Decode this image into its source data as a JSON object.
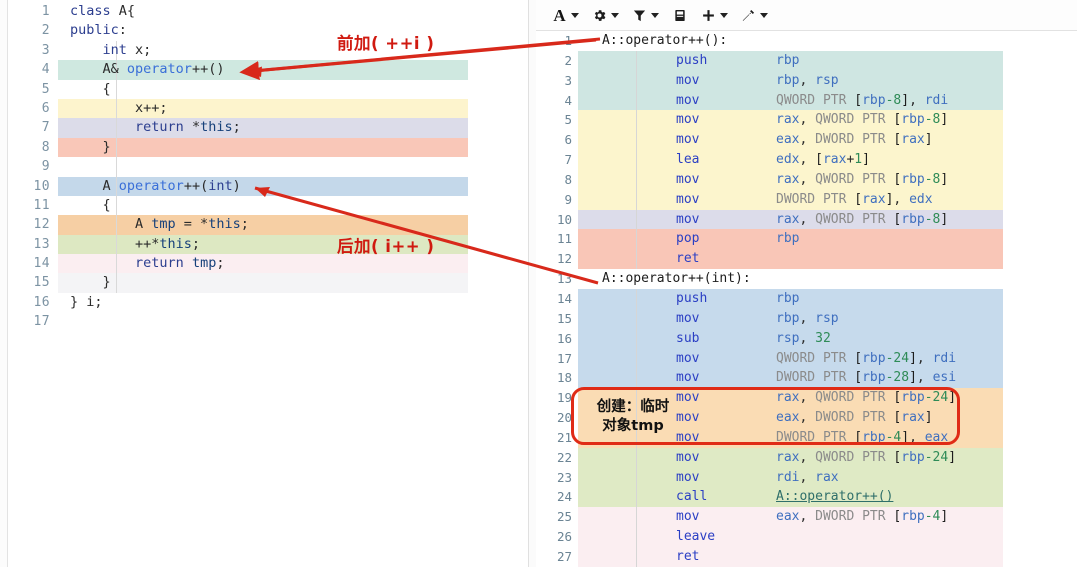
{
  "toolbar": {
    "buttons": [
      {
        "name": "font-button",
        "icon": "letter-A-icon",
        "label": "A",
        "caret": true
      },
      {
        "name": "settings-button",
        "icon": "gear-icon",
        "label": "",
        "caret": true
      },
      {
        "name": "filter-button",
        "icon": "filter-funnel-icon",
        "label": "",
        "caret": true
      },
      {
        "name": "layout-button",
        "icon": "panel-book-icon",
        "label": "",
        "caret": false
      },
      {
        "name": "add-button",
        "icon": "plus-icon",
        "label": "",
        "caret": true
      },
      {
        "name": "tools-button",
        "icon": "wand-icon",
        "label": "",
        "caret": true
      }
    ]
  },
  "editor": {
    "lines": [
      {
        "n": "1",
        "text": "class A{",
        "hl": "none",
        "guide": false
      },
      {
        "n": "2",
        "text": "public:",
        "hl": "none",
        "guide": false
      },
      {
        "n": "3",
        "text": "    int x;",
        "hl": "none",
        "guide": true
      },
      {
        "n": "4",
        "text": "    A& operator++()",
        "hl": "#cfe8e0",
        "guide": true
      },
      {
        "n": "5",
        "text": "    {",
        "hl": "none",
        "guide": true
      },
      {
        "n": "6",
        "text": "        x++;",
        "hl": "#fdf4cd",
        "guide": true
      },
      {
        "n": "7",
        "text": "        return *this;",
        "hl": "#dcdce9",
        "guide": true
      },
      {
        "n": "8",
        "text": "    }",
        "hl": "#f9c7b8",
        "guide": true
      },
      {
        "n": "9",
        "text": "",
        "hl": "none",
        "guide": true
      },
      {
        "n": "10",
        "text": "    A operator++(int)",
        "hl": "#c4d8ea",
        "guide": true
      },
      {
        "n": "11",
        "text": "    {",
        "hl": "none",
        "guide": true
      },
      {
        "n": "12",
        "text": "        A tmp = *this;",
        "hl": "#f6cfa4",
        "guide": true
      },
      {
        "n": "13",
        "text": "        ++*this;",
        "hl": "#dde8c2",
        "guide": true
      },
      {
        "n": "14",
        "text": "        return tmp;",
        "hl": "#fbeef1",
        "guide": true
      },
      {
        "n": "15",
        "text": "    }",
        "hl": "#f4f4f6",
        "guide": true
      },
      {
        "n": "16",
        "text": "} i;",
        "hl": "none",
        "guide": false
      },
      {
        "n": "17",
        "text": "",
        "hl": "none",
        "guide": false
      }
    ]
  },
  "assembly": {
    "lines": [
      {
        "n": "1",
        "label": "A::operator++():",
        "mn": "",
        "op": "",
        "hl": "none"
      },
      {
        "n": "2",
        "label": "",
        "mn": "push",
        "op": "rbp",
        "hl": "#cfe6e2"
      },
      {
        "n": "3",
        "label": "",
        "mn": "mov",
        "op": "rbp, rsp",
        "hl": "#cfe6e2"
      },
      {
        "n": "4",
        "label": "",
        "mn": "mov",
        "op": "QWORD PTR [rbp-8], rdi",
        "hl": "#cfe6e2"
      },
      {
        "n": "5",
        "label": "",
        "mn": "mov",
        "op": "rax, QWORD PTR [rbp-8]",
        "hl": "#fcf5cd"
      },
      {
        "n": "6",
        "label": "",
        "mn": "mov",
        "op": "eax, DWORD PTR [rax]",
        "hl": "#fcf5cd"
      },
      {
        "n": "7",
        "label": "",
        "mn": "lea",
        "op": "edx, [rax+1]",
        "hl": "#fcf5cd"
      },
      {
        "n": "8",
        "label": "",
        "mn": "mov",
        "op": "rax, QWORD PTR [rbp-8]",
        "hl": "#fcf5cd"
      },
      {
        "n": "9",
        "label": "",
        "mn": "mov",
        "op": "DWORD PTR [rax], edx",
        "hl": "#fcf5cd"
      },
      {
        "n": "10",
        "label": "",
        "mn": "mov",
        "op": "rax, QWORD PTR [rbp-8]",
        "hl": "#dcdcea"
      },
      {
        "n": "11",
        "label": "",
        "mn": "pop",
        "op": "rbp",
        "hl": "#f9c6b7"
      },
      {
        "n": "12",
        "label": "",
        "mn": "ret",
        "op": "",
        "hl": "#f9c6b7"
      },
      {
        "n": "13",
        "label": "A::operator++(int):",
        "mn": "",
        "op": "",
        "hl": "none"
      },
      {
        "n": "14",
        "label": "",
        "mn": "push",
        "op": "rbp",
        "hl": "#c6daec"
      },
      {
        "n": "15",
        "label": "",
        "mn": "mov",
        "op": "rbp, rsp",
        "hl": "#c6daec"
      },
      {
        "n": "16",
        "label": "",
        "mn": "sub",
        "op": "rsp, 32",
        "hl": "#c6daec"
      },
      {
        "n": "17",
        "label": "",
        "mn": "mov",
        "op": "QWORD PTR [rbp-24], rdi",
        "hl": "#c6daec"
      },
      {
        "n": "18",
        "label": "",
        "mn": "mov",
        "op": "DWORD PTR [rbp-28], esi",
        "hl": "#c6daec"
      },
      {
        "n": "19",
        "label": "",
        "mn": "mov",
        "op": "rax, QWORD PTR [rbp-24]",
        "hl": "#fadcb4"
      },
      {
        "n": "20",
        "label": "",
        "mn": "mov",
        "op": "eax, DWORD PTR [rax]",
        "hl": "#fadcb4"
      },
      {
        "n": "21",
        "label": "",
        "mn": "mov",
        "op": "DWORD PTR [rbp-4], eax",
        "hl": "#fadcb4"
      },
      {
        "n": "22",
        "label": "",
        "mn": "mov",
        "op": "rax, QWORD PTR [rbp-24]",
        "hl": "#dfeac5"
      },
      {
        "n": "23",
        "label": "",
        "mn": "mov",
        "op": "rdi, rax",
        "hl": "#dfeac5"
      },
      {
        "n": "24",
        "label": "",
        "mn": "call",
        "op": "A::operator++()",
        "hl": "#dfeac5",
        "link": true
      },
      {
        "n": "25",
        "label": "",
        "mn": "mov",
        "op": "eax, DWORD PTR [rbp-4]",
        "hl": "#fbeef1"
      },
      {
        "n": "26",
        "label": "",
        "mn": "leave",
        "op": "",
        "hl": "#fbeef1"
      },
      {
        "n": "27",
        "label": "",
        "mn": "ret",
        "op": "",
        "hl": "#fbeef1"
      }
    ]
  },
  "annotations": {
    "pre_increment_label": "前加( ++i )",
    "post_increment_label": "后加( i++ )",
    "temp_object_note": "创建：临时\n对象tmp",
    "accent_color": "#d01a10"
  }
}
